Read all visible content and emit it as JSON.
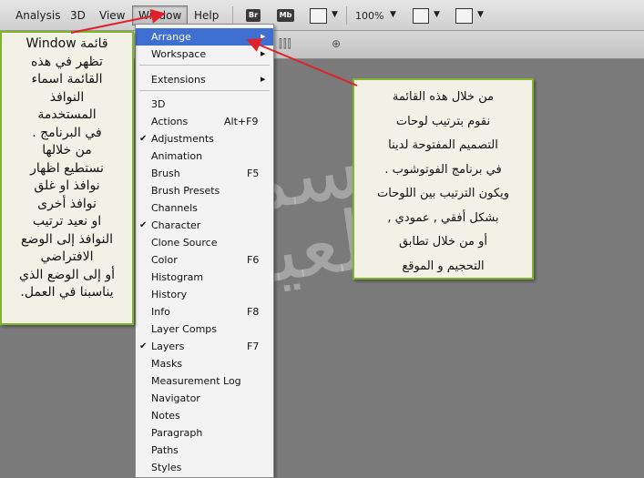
{
  "menubar": {
    "items": [
      "Analysis",
      "3D",
      "View",
      "Window",
      "Help"
    ],
    "active": "Window",
    "toolbar": {
      "bridge_label": "Br",
      "minibridge_label": "Mb",
      "zoom": "100%"
    }
  },
  "window_menu": {
    "items": [
      {
        "label": "Arrange",
        "submenu": true,
        "highlighted": true
      },
      {
        "label": "Workspace",
        "submenu": true
      },
      {
        "label": "Extensions",
        "submenu": true
      },
      {
        "label": "3D"
      },
      {
        "label": "Actions",
        "shortcut": "Alt+F9"
      },
      {
        "label": "Adjustments",
        "checked": true
      },
      {
        "label": "Animation"
      },
      {
        "label": "Brush",
        "shortcut": "F5"
      },
      {
        "label": "Brush Presets"
      },
      {
        "label": "Channels"
      },
      {
        "label": "Character",
        "checked": true
      },
      {
        "label": "Clone Source"
      },
      {
        "label": "Color",
        "shortcut": "F6"
      },
      {
        "label": "Histogram"
      },
      {
        "label": "History"
      },
      {
        "label": "Info",
        "shortcut": "F8"
      },
      {
        "label": "Layer Comps"
      },
      {
        "label": "Layers",
        "shortcut": "F7",
        "checked": true
      },
      {
        "label": "Masks"
      },
      {
        "label": "Measurement Log"
      },
      {
        "label": "Navigator"
      },
      {
        "label": "Notes"
      },
      {
        "label": "Paragraph"
      },
      {
        "label": "Paths"
      },
      {
        "label": "Styles"
      }
    ]
  },
  "callouts": {
    "left_text": "قائمة Window\nتظهر في هذه\nالقائمة اسماء\nالنوافذ\nالمستخدمة\nفي البرنامج .\nمن خلالها\nنستطيع اظهار\nنوافذ او غلق\nنوافذ أخرى\nاو نعيد ترتيب\nالنوافذ إلى الوضع\nالافتراضي\nأو إلى الوضع الذي\nيناسبنا في العمل.",
    "right_text": "من خلال هذه القائمة\nنقوم بترتيب لوحات\nالتصميم المفتوحة لدينا\nفي برنامج الفوتوشوب .\nويكون الترتيب بين اللوحات\nبشكل أفقي , عمودي ,\nأو من خلال تطابق\nالتحجيم و الموقع"
  },
  "watermark": {
    "text": "سمير العيدي"
  },
  "colors": {
    "highlight": "#3e6fd1",
    "callout_border": "#7fb52a",
    "arrow": "#e0202a"
  }
}
